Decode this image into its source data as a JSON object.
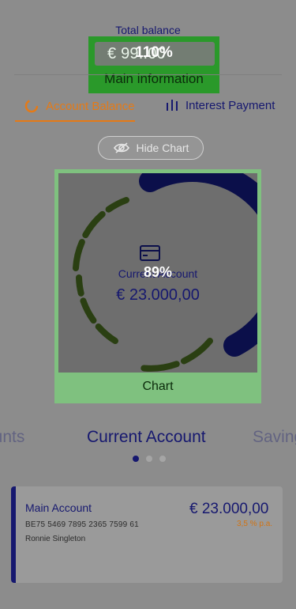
{
  "header": {
    "total_label": "Total balance",
    "balance_text": "€ 99.‌‌.00",
    "overlay_percent": "110%",
    "overlay_label": "Main information"
  },
  "tabs": {
    "account_balance": "Account Balance",
    "interest_payment": "Interest Payment"
  },
  "hide_chart_label": "Hide Chart",
  "chart": {
    "center_label": "Current Account",
    "center_amount": "€ 23.000,00",
    "overlay_percent": "89%",
    "caption": "Chart"
  },
  "carousel": {
    "left": "ounts",
    "center": "Current Account",
    "right": "Saving",
    "dots_active_index": 0
  },
  "card": {
    "name": "Main Account",
    "amount": "€ 23.000,00",
    "iban": "BE75 5469 7895 2365 7599 61",
    "rate": "3,5 % p.a.",
    "owner": "Ronnie Singleton"
  },
  "colors": {
    "brand": "#16186f",
    "accent": "#e57a16",
    "highlight": "#1f9a1f"
  }
}
